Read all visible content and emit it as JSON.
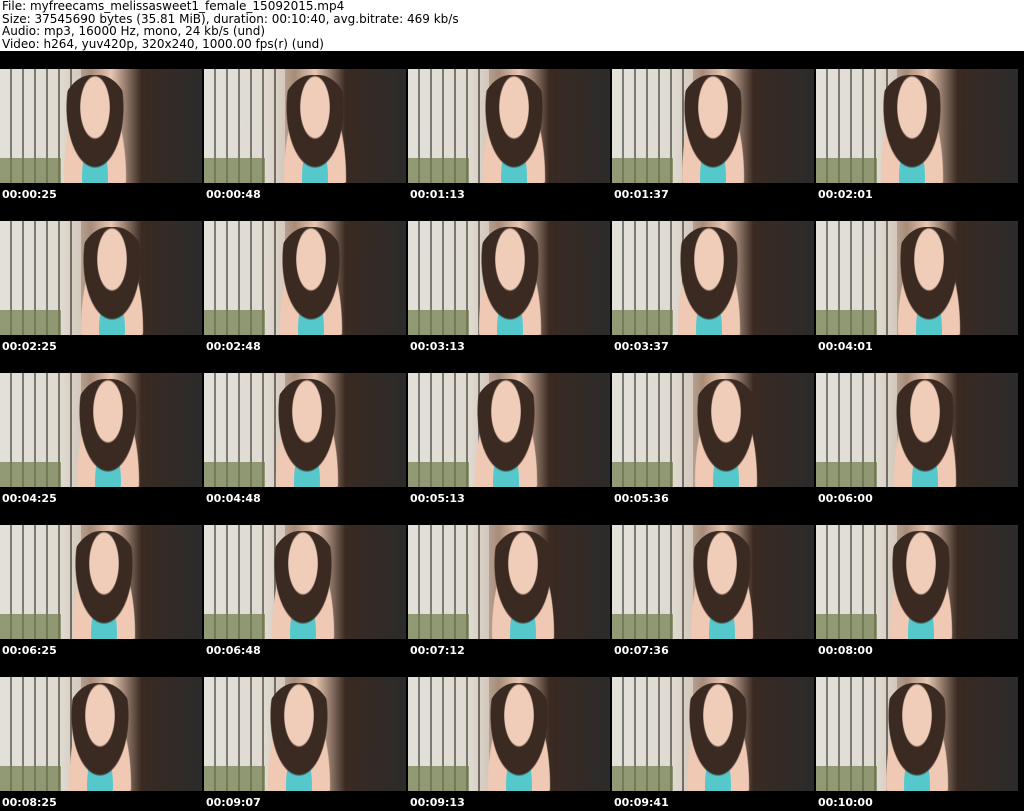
{
  "header": {
    "file": "File: myfreecams_melissasweet1_female_15092015.mp4",
    "size": "Size: 37545690 bytes (35.81 MiB), duration: 00:10:40, avg.bitrate: 469 kb/s",
    "audio": "Audio: mp3, 16000 Hz, mono, 24 kb/s (und)",
    "video": "Video: h264, yuv420p, 320x240, 1000.00 fps(r) (und)"
  },
  "thumbnails": [
    "00:00:25",
    "00:00:48",
    "00:01:13",
    "00:01:37",
    "00:02:01",
    "00:02:25",
    "00:02:48",
    "00:03:13",
    "00:03:37",
    "00:04:01",
    "00:04:25",
    "00:04:48",
    "00:05:13",
    "00:05:36",
    "00:06:00",
    "00:06:25",
    "00:06:48",
    "00:07:12",
    "00:07:36",
    "00:08:00",
    "00:08:25",
    "00:09:07",
    "00:09:13",
    "00:09:41",
    "00:10:00"
  ]
}
